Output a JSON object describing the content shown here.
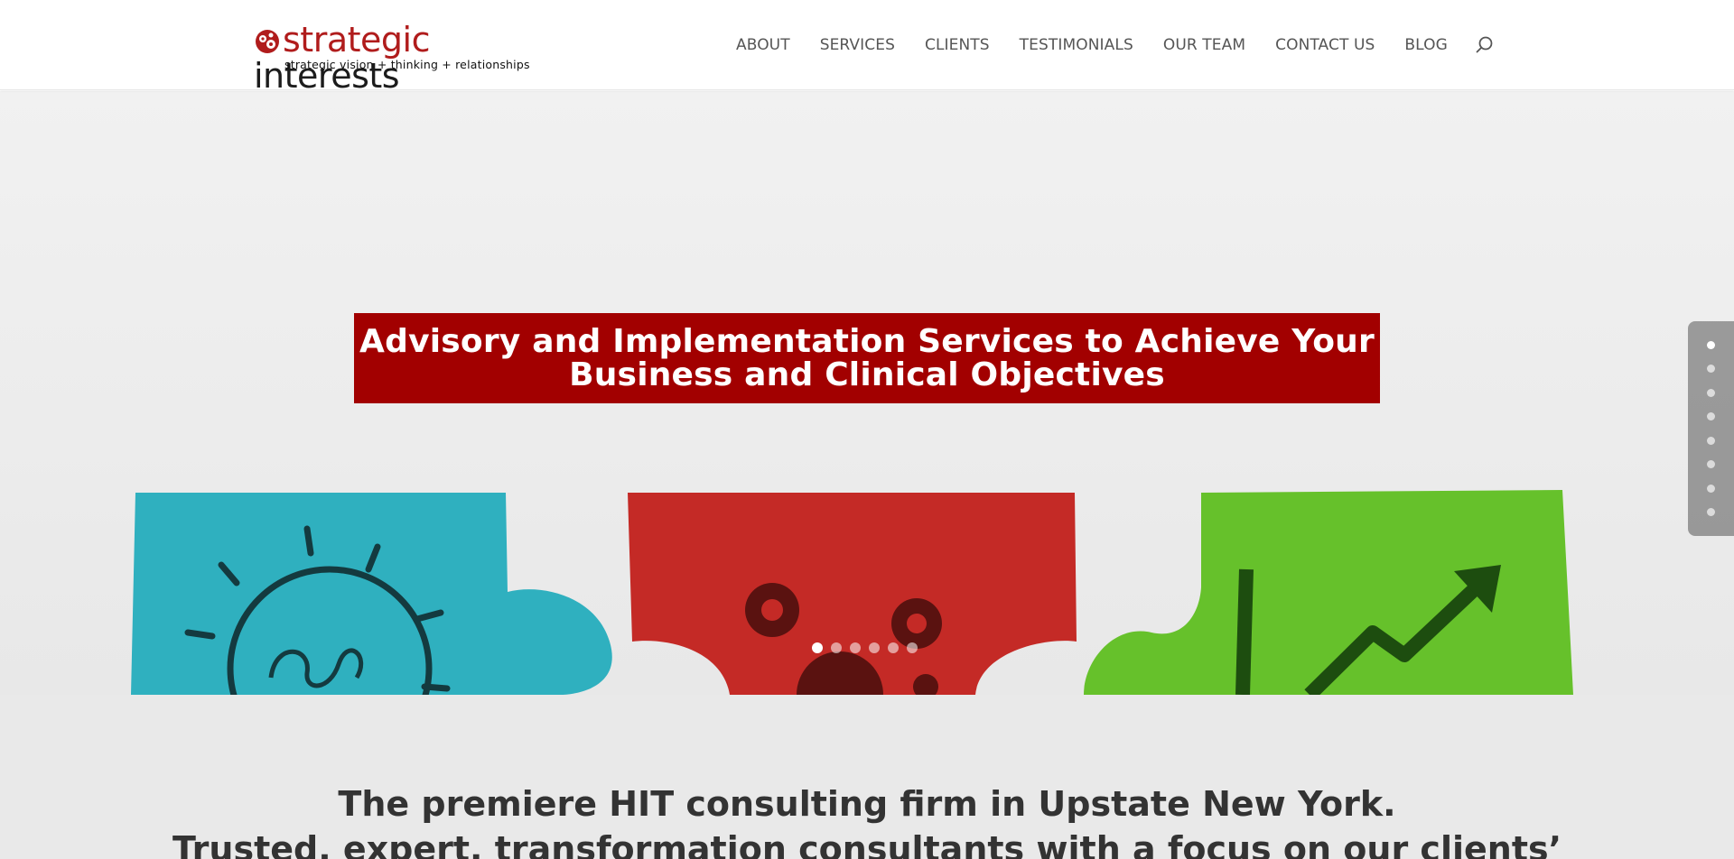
{
  "brand": {
    "name_part1": "strategic",
    "name_part2": "interests",
    "tagline": "strategic vision + thinking + relationships",
    "accent_color": "#a20000"
  },
  "nav": {
    "items": [
      "ABOUT",
      "SERVICES",
      "CLIENTS",
      "TESTIMONIALS",
      "OUR TEAM",
      "CONTACT US",
      "BLOG"
    ],
    "search_icon": "search-icon"
  },
  "hero": {
    "headline_line1": "Advisory and Implementation Services to Achieve Your",
    "headline_line2": "Business and Clinical Objectives",
    "slide_count": 6,
    "active_slide": 1,
    "puzzle_icons": [
      "lightbulb-icon",
      "gears-icon",
      "growth-chart-icon"
    ]
  },
  "side_nav": {
    "section_count": 8,
    "active_section": 1
  },
  "intro": {
    "line1": "The premiere HIT consulting firm in Upstate New York.",
    "line2": "Trusted, expert, transformation consultants with a focus on our clients’"
  }
}
